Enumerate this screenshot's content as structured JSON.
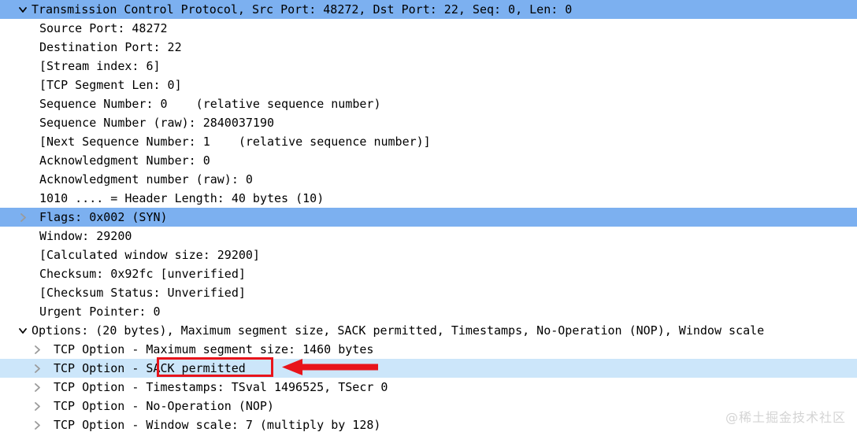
{
  "colors": {
    "selection_strong": "#7cb0f0",
    "selection_light": "#cce6fa",
    "annotation_red": "#e8141b",
    "text": "#000000",
    "twisty_gray": "#9a9a9a",
    "watermark": "#d4d4d4"
  },
  "tree": {
    "rows": [
      {
        "label": "Transmission Control Protocol, Src Port: 48272, Dst Port: 22, Seq: 0, Len: 0",
        "twisty": "expanded",
        "highlight": "strong",
        "indent": "lvl0",
        "name": "tree-row-tcp-protocol"
      },
      {
        "label": "Source Port: 48272",
        "twisty": "none",
        "highlight": "none",
        "indent": "lvl1",
        "name": "tree-row-source-port"
      },
      {
        "label": "Destination Port: 22",
        "twisty": "none",
        "highlight": "none",
        "indent": "lvl1",
        "name": "tree-row-destination-port"
      },
      {
        "label": "[Stream index: 6]",
        "twisty": "none",
        "highlight": "none",
        "indent": "lvl1",
        "name": "tree-row-stream-index"
      },
      {
        "label": "[TCP Segment Len: 0]",
        "twisty": "none",
        "highlight": "none",
        "indent": "lvl1",
        "name": "tree-row-tcp-segment-len"
      },
      {
        "label": "Sequence Number: 0    (relative sequence number)",
        "twisty": "none",
        "highlight": "none",
        "indent": "lvl1",
        "name": "tree-row-sequence-number"
      },
      {
        "label": "Sequence Number (raw): 2840037190",
        "twisty": "none",
        "highlight": "none",
        "indent": "lvl1",
        "name": "tree-row-sequence-number-raw"
      },
      {
        "label": "[Next Sequence Number: 1    (relative sequence number)]",
        "twisty": "none",
        "highlight": "none",
        "indent": "lvl1",
        "name": "tree-row-next-sequence-number"
      },
      {
        "label": "Acknowledgment Number: 0",
        "twisty": "none",
        "highlight": "none",
        "indent": "lvl1",
        "name": "tree-row-acknowledgment-number"
      },
      {
        "label": "Acknowledgment number (raw): 0",
        "twisty": "none",
        "highlight": "none",
        "indent": "lvl1",
        "name": "tree-row-acknowledgment-number-raw"
      },
      {
        "label": "1010 .... = Header Length: 40 bytes (10)",
        "twisty": "none",
        "highlight": "none",
        "indent": "lvl1",
        "name": "tree-row-header-length"
      },
      {
        "label": "Flags: 0x002 (SYN)",
        "twisty": "collapsed1",
        "highlight": "strong",
        "indent": "lvl1",
        "name": "tree-row-flags"
      },
      {
        "label": "Window: 29200",
        "twisty": "none",
        "highlight": "none",
        "indent": "lvl1",
        "name": "tree-row-window"
      },
      {
        "label": "[Calculated window size: 29200]",
        "twisty": "none",
        "highlight": "none",
        "indent": "lvl1",
        "name": "tree-row-calculated-window-size"
      },
      {
        "label": "Checksum: 0x92fc [unverified]",
        "twisty": "none",
        "highlight": "none",
        "indent": "lvl1",
        "name": "tree-row-checksum"
      },
      {
        "label": "[Checksum Status: Unverified]",
        "twisty": "none",
        "highlight": "none",
        "indent": "lvl1",
        "name": "tree-row-checksum-status"
      },
      {
        "label": "Urgent Pointer: 0",
        "twisty": "none",
        "highlight": "none",
        "indent": "lvl1",
        "name": "tree-row-urgent-pointer"
      },
      {
        "label": "Options: (20 bytes), Maximum segment size, SACK permitted, Timestamps, No-Operation (NOP), Window scale",
        "twisty": "expanded2",
        "highlight": "none",
        "indent": "lvl2",
        "name": "tree-row-options"
      },
      {
        "label": "TCP Option - Maximum segment size: 1460 bytes",
        "twisty": "collapsed2",
        "highlight": "none",
        "indent": "lvl3",
        "name": "tree-row-option-mss"
      },
      {
        "label": "TCP Option - SACK permitted",
        "twisty": "collapsed2",
        "highlight": "light",
        "indent": "lvl3",
        "name": "tree-row-option-sack-permitted"
      },
      {
        "label": "TCP Option - Timestamps: TSval 1496525, TSecr 0",
        "twisty": "collapsed2",
        "highlight": "none",
        "indent": "lvl3",
        "name": "tree-row-option-timestamps"
      },
      {
        "label": "TCP Option - No-Operation (NOP)",
        "twisty": "collapsed2",
        "highlight": "none",
        "indent": "lvl3",
        "name": "tree-row-option-nop"
      },
      {
        "label": "TCP Option - Window scale: 7 (multiply by 128)",
        "twisty": "collapsed2",
        "highlight": "none",
        "indent": "lvl3",
        "name": "tree-row-option-window-scale"
      }
    ]
  },
  "annotation": {
    "highlighted_text": "SACK permitted",
    "box_name": "annotation-highlight-box",
    "arrow_name": "annotation-arrow-icon"
  },
  "watermark": {
    "text": "@稀土掘金技术社区"
  }
}
